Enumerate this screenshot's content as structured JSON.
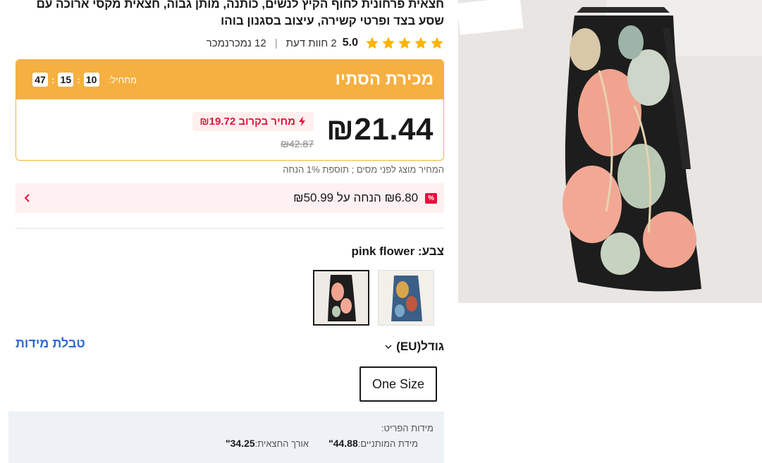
{
  "product": {
    "title": "חצאית פרחונית לחוף הקיץ לנשים, כותנה, מותן גבוה, חצאית מקסי ארוכה עם שסע בצד ופרטי קשירה, עיצוב בסגנון בוהו"
  },
  "rating": {
    "score": "5.0",
    "stars": 5,
    "reviews": "2 חוות דעת",
    "sold": "12 נמכרנמכר"
  },
  "flash_sale": {
    "title": "מכירת הסתיו",
    "starts_label": "מתחיל:",
    "hours": "10",
    "minutes": "15",
    "seconds": "47",
    "price": "₪21.44",
    "soon_price": "מחיר בקרוב ₪19.72",
    "old_price": "₪42.87"
  },
  "tax_note": "המחיר מוצג לפני מסים ; תוספת 1% הנחה",
  "coupon": {
    "badge": "%",
    "text": "₪6.80 הנחה על ₪50.99"
  },
  "color": {
    "label": "צבע:",
    "value": "pink flower"
  },
  "size": {
    "label": "גודל(EU)",
    "chart_link": "טבלת מידות",
    "options": [
      "One Size"
    ]
  },
  "measurements": {
    "title": "מידות הפריט:",
    "waist_label": "מידת המותניים:",
    "waist_value": "44.88\"",
    "length_label": "אורך החצאית:",
    "length_value": "34.25\""
  },
  "colors": {
    "accent_orange": "#f5b041",
    "price_red": "#e5103a",
    "link_blue": "#2e6ad6",
    "star_gold": "#ffb400"
  }
}
